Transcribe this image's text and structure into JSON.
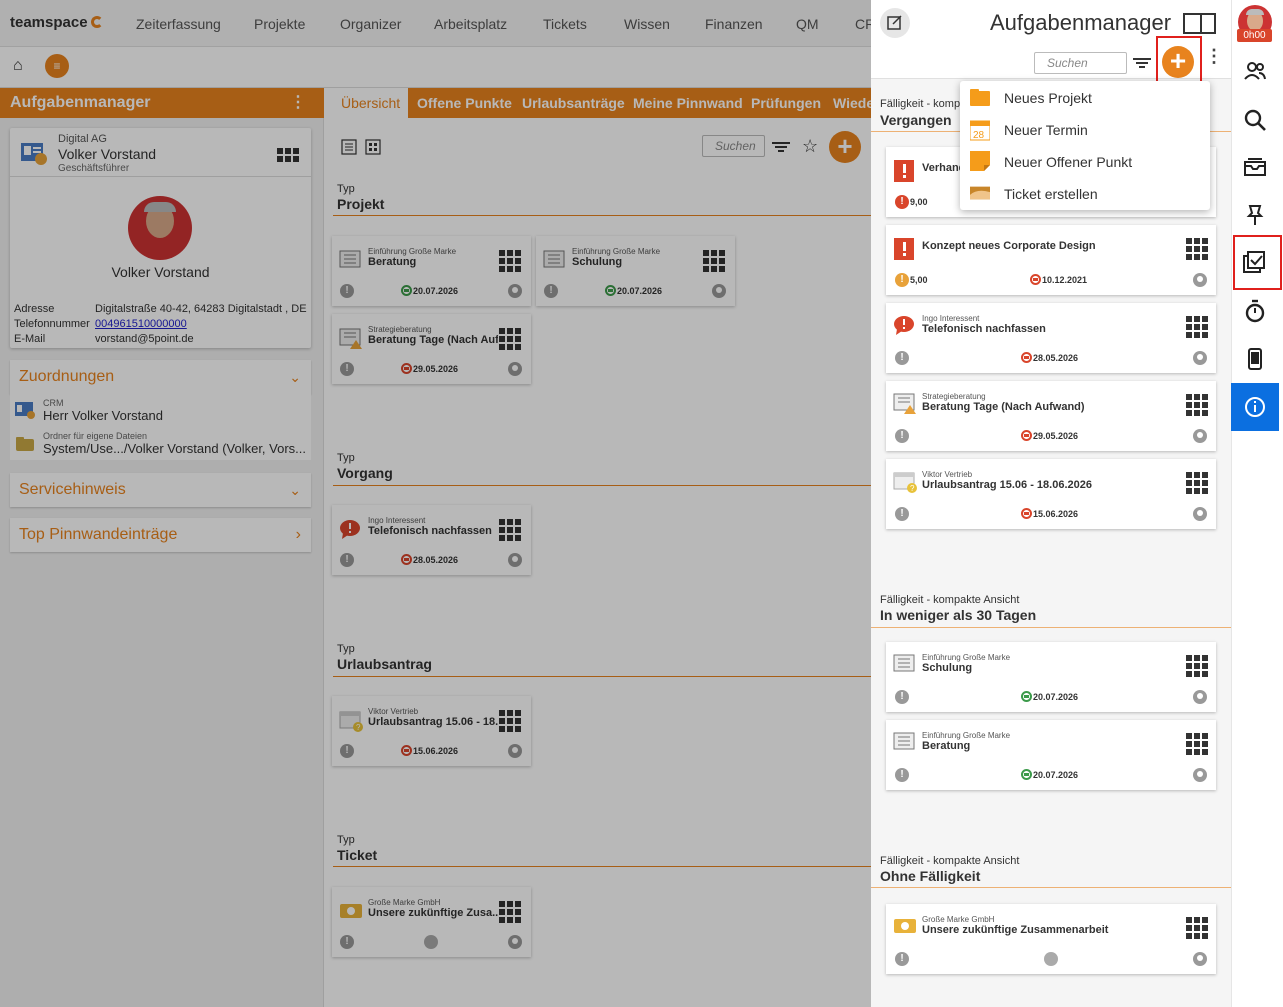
{
  "topnav": {
    "logo": "teamspace",
    "items": [
      "Zeiterfassung",
      "Projekte",
      "Organizer",
      "Arbeitsplatz",
      "Tickets",
      "Wissen",
      "Finanzen",
      "QM",
      "CR"
    ]
  },
  "left": {
    "header": "Aufgabenmanager",
    "company": "Digital AG",
    "name": "Volker Vorstand",
    "role": "Geschäftsführer",
    "photo_name": "Volker Vorstand",
    "address_label": "Adresse",
    "address": "Digitalstraße 40-42, 64283 Digitalstadt , DE",
    "phone_label": "Telefonnummer",
    "phone": "004961510000000",
    "email_label": "E-Mail",
    "email": "vorstand@5point.de",
    "zuordnungen": "Zuordnungen",
    "crm_label": "CRM",
    "crm_value": "Herr Volker Vorstand",
    "ordner_label": "Ordner für eigene Dateien",
    "ordner_value": "System/Use.../Volker Vorstand (Volker, Vors...",
    "servicehinweis": "Servicehinweis",
    "pinnwand": "Top Pinnwandeinträge"
  },
  "main": {
    "tabs": [
      "Übersicht",
      "Offene Punkte",
      "Urlaubsanträge",
      "Meine Pinnwand",
      "Prüfungen",
      "Wiede"
    ],
    "search_placeholder": "Suchen",
    "type_label": "Typ",
    "groups": {
      "projekt": "Projekt",
      "vorgang": "Vorgang",
      "urlaub": "Urlaubsantrag",
      "ticket": "Ticket"
    },
    "cards": [
      {
        "sub": "Einführung Große Marke",
        "title": "Beratung",
        "date": "20.07.2026"
      },
      {
        "sub": "Einführung Große Marke",
        "title": "Schulung",
        "date": "20.07.2026"
      },
      {
        "sub": "Strategieberatung",
        "title": "Beratung Tage (Nach Auf...",
        "date": "29.05.2026"
      },
      {
        "sub": "Ingo Interessent",
        "title": "Telefonisch nachfassen",
        "date": "28.05.2026"
      },
      {
        "sub": "Viktor Vertrieb",
        "title": "Urlaubsantrag 15.06 - 18...",
        "date": "15.06.2026"
      },
      {
        "sub": "Große Marke GmbH",
        "title": "Unsere zukünftige Zusa..."
      }
    ]
  },
  "right": {
    "title": "Aufgabenmanager",
    "user_badge": "0h00",
    "search_placeholder": "Suchen",
    "sec1_label": "Fälligkeit - komp",
    "sec1_value": "Vergangen",
    "sec2_label": "Fälligkeit - kompakte Ansicht",
    "sec2_value": "In weniger als 30 Tagen",
    "sec3_label": "Fälligkeit - kompakte Ansicht",
    "sec3_value": "Ohne Fälligkeit",
    "cards": [
      {
        "title": "Verhand",
        "value": "9,00"
      },
      {
        "title": "Konzept neues Corporate Design",
        "value": "5,00",
        "date": "10.12.2021"
      },
      {
        "sub": "Ingo Interessent",
        "title": "Telefonisch nachfassen",
        "date": "28.05.2026"
      },
      {
        "sub": "Strategieberatung",
        "title": "Beratung Tage (Nach Aufwand)",
        "date": "29.05.2026"
      },
      {
        "sub": "Viktor Vertrieb",
        "title": "Urlaubsantrag 15.06 - 18.06.2026",
        "date": "15.06.2026"
      },
      {
        "sub": "Einführung Große Marke",
        "title": "Schulung",
        "date": "20.07.2026"
      },
      {
        "sub": "Einführung Große Marke",
        "title": "Beratung",
        "date": "20.07.2026"
      },
      {
        "sub": "Große Marke GmbH",
        "title": "Unsere zukünftige Zusammenarbeit"
      }
    ]
  },
  "dropdown": [
    "Neues Projekt",
    "Neuer Termin",
    "Neuer Offener Punkt",
    "Ticket erstellen"
  ],
  "termin_day": "28",
  "colors": {
    "accent": "#e8831e",
    "danger": "#d9452b",
    "info": "#0b6fe0",
    "highlight": "#e0201c"
  }
}
